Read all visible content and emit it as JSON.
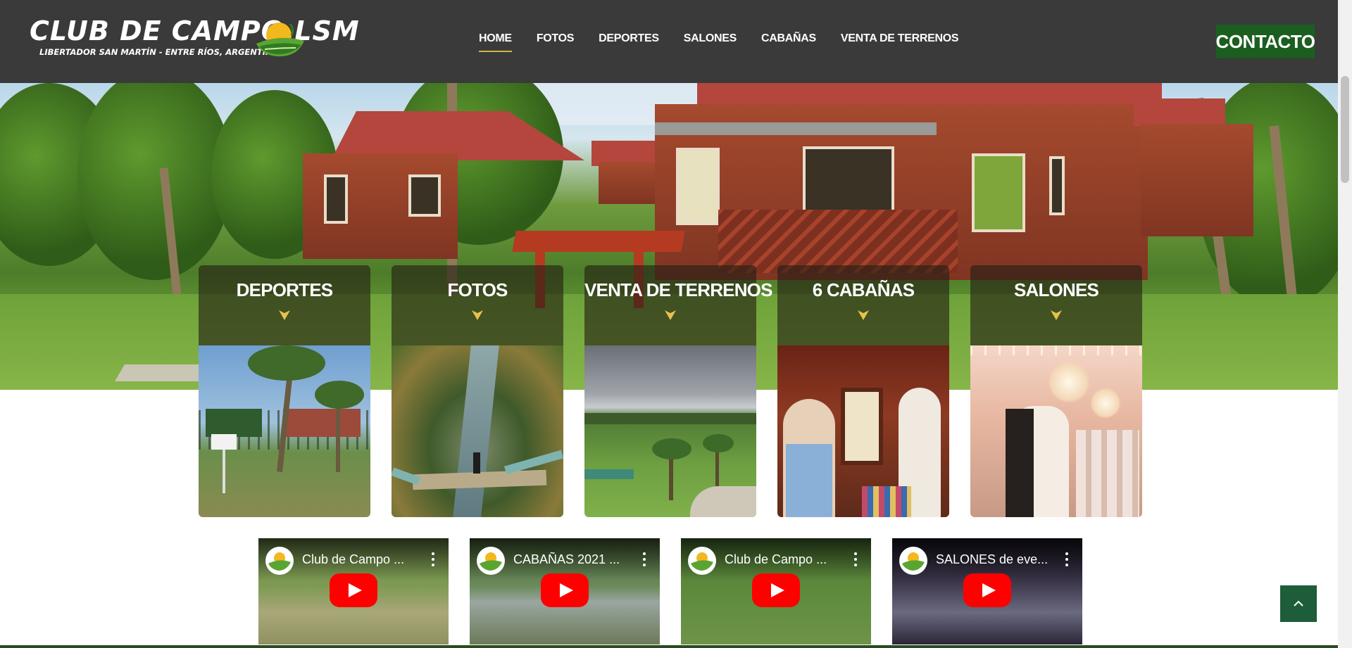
{
  "brand": {
    "title": "CLUB DE CAMPO LSM",
    "subtitle": "LIBERTADOR SAN MARTÍN - ENTRE RÍOS, ARGENTINA"
  },
  "nav": {
    "items": [
      {
        "label": "HOME",
        "active": true
      },
      {
        "label": "FOTOS"
      },
      {
        "label": "DEPORTES"
      },
      {
        "label": "SALONES"
      },
      {
        "label": "CABAÑAS"
      },
      {
        "label": "VENTA DE TERRENOS"
      }
    ]
  },
  "contact": {
    "label": "CONTACTO"
  },
  "cards": [
    {
      "title": "DEPORTES"
    },
    {
      "title": "FOTOS"
    },
    {
      "title": "VENTA DE TERRENOS"
    },
    {
      "title": "6 CABAÑAS"
    },
    {
      "title": "SALONES"
    }
  ],
  "videos": [
    {
      "title": "Club de Campo ..."
    },
    {
      "title": "CABAÑAS 2021 ..."
    },
    {
      "title": "Club de Campo ..."
    },
    {
      "title": "SALONES de eve..."
    }
  ],
  "colors": {
    "header_bg": "#3a3a3a",
    "contact_bg": "#1b5e20",
    "nav_underline": "#d7b04a",
    "arrow": "#e8c24a",
    "back_to_top_bg": "#1d5d3a"
  },
  "icons": {
    "logo": "sun-landscape-logo",
    "card_arrow": "arrow-down-icon",
    "play": "youtube-play-icon",
    "menu": "more-vert-icon",
    "back_to_top": "chevron-up-icon"
  }
}
